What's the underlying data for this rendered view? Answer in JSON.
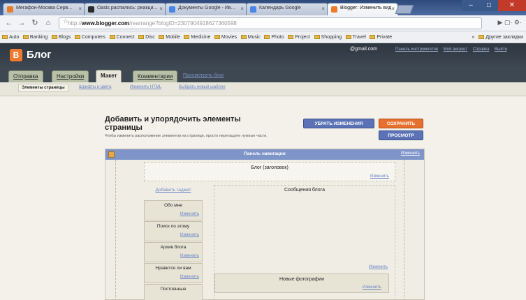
{
  "browser": {
    "tabs": [
      {
        "label": "Мегафон-Москва Серв...",
        "active": false,
        "favicon_color": "#e87c2a"
      },
      {
        "label": "Oasis распались: реакци...",
        "active": false,
        "favicon_color": "#2a2a2a"
      },
      {
        "label": "Документы Google - Ив...",
        "active": false,
        "favicon_color": "#4a86e8"
      },
      {
        "label": "Календарь Google",
        "active": false,
        "favicon_color": "#4a86e8"
      },
      {
        "label": "Blogger: Изменить вид",
        "active": true,
        "favicon_color": "#f27a2c"
      }
    ],
    "url_prefix": "http://",
    "url_host": "www.blogger.com",
    "url_path": "/rearrange?blogID=2307904918627360598",
    "bookmarks": [
      "Auto",
      "Banking",
      "Blogs",
      "Computers",
      "Connect",
      "Disc",
      "Mobile",
      "Medicine",
      "Movies",
      "Music",
      "Photo",
      "Project",
      "Shopping",
      "Travel",
      "Private"
    ],
    "bookmarks_right": "Другие закладки"
  },
  "blogger": {
    "title": "Блог",
    "user": "@gmail.com",
    "header_links": [
      "Панель инструментов",
      "Мой аккаунт",
      "Справка",
      "Выйти"
    ],
    "main_tabs": [
      {
        "label": "Отправка",
        "active": false
      },
      {
        "label": "Настройки",
        "active": false
      },
      {
        "label": "Макет",
        "active": true
      },
      {
        "label": "Комментарии",
        "active": false
      }
    ],
    "view_blog_link": "Просмотреть блог",
    "sub_tabs": [
      {
        "label": "Элементы страницы",
        "active": true
      },
      {
        "label": "Шрифты и цвета",
        "active": false
      },
      {
        "label": "Изменить HTML",
        "active": false
      },
      {
        "label": "Выбрать новый шаблон",
        "active": false
      }
    ]
  },
  "content": {
    "title": "Добавить и упорядочить элементы страницы",
    "description": "Чтобы изменить расположение элементов на странице, просто перетащите нужные части.",
    "clear_button": "УБРАТЬ ИЗМЕНЕНИЯ",
    "save_button": "СОХРАНИТЬ",
    "preview_button": "ПРОСМОТР",
    "nav_panel": "Панель навигации",
    "edit_label": "Изменить",
    "header_widget": "Блог (заголовок)",
    "add_gadget": "Добавить гаджет",
    "gadgets": [
      "Обо мне",
      "Поиск по этому",
      "Архив блога",
      "Нравится ли вам",
      "Постоянные"
    ],
    "posts_widget": "Сообщения блога",
    "photos_widget": "Новые фотографии"
  }
}
